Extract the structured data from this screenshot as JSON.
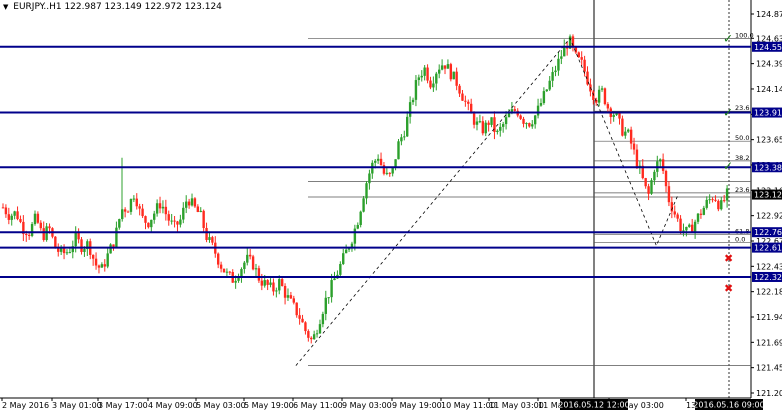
{
  "window": {
    "symbol_label": "EURJPY..H1",
    "ohlc": "122.987 123.149 122.972 123.124",
    "menu_icon": "triangle-down-icon"
  },
  "colors": {
    "bull": "#2ca02c",
    "bear": "#ff2a1f",
    "hline": "#00008b",
    "tag_bg": "#00008b",
    "current_bg": "#000000",
    "grid_text": "#000000",
    "fib": "#000000",
    "check": "#1a7a1a",
    "cross": "#e01010"
  },
  "chart_data": {
    "type": "candlestick",
    "ylim": [
      121.45,
      124.85
    ],
    "y_ticks": [
      "124.870",
      "124.635",
      "124.390",
      "124.145",
      "123.900",
      "123.655",
      "123.410",
      "123.165",
      "122.920",
      "122.675",
      "122.430",
      "122.185",
      "121.940",
      "121.695",
      "121.450",
      "121.205"
    ],
    "x_ticks": [
      "2 May 2016",
      "3 May 01:00",
      "3 May 17:00",
      "4 May 09:00",
      "5 May 03:00",
      "5 May 19:00",
      "6 May 11:00",
      "9 May 03:00",
      "9 May 19:00",
      "10 May 11:00",
      "11 May 03:00",
      "11 Ma",
      "13 May 03:00",
      "13 M"
    ],
    "highlighted_time_labels": [
      "2016.05.12 12:00",
      "2016.05.16 09:00"
    ],
    "current_price": "123.124",
    "horizontal_levels": [
      {
        "price": 124.553,
        "label": "124.553"
      },
      {
        "price": 123.917,
        "label": "123.917"
      },
      {
        "price": 123.388,
        "label": "123.388"
      },
      {
        "price": 122.76,
        "label": "122.760"
      },
      {
        "price": 122.611,
        "label": "122.611"
      },
      {
        "price": 122.327,
        "label": "122.327"
      }
    ],
    "fib_levels_left": [
      {
        "pct": "100.0",
        "price": 124.635
      },
      {
        "pct": "0.0",
        "price": 121.47
      }
    ],
    "fib_levels_right": [
      {
        "pct": "100.0",
        "price": 124.635
      },
      {
        "pct": "23.6",
        "price": 123.93
      },
      {
        "pct": "50.0",
        "price": 123.64
      },
      {
        "pct": "38.2",
        "price": 123.45
      },
      {
        "pct": "23.6",
        "price": 123.14
      },
      {
        "pct": "61.8",
        "price": 122.74
      },
      {
        "pct": "0.0",
        "price": 122.66
      }
    ],
    "price_path": [
      123.0,
      122.92,
      122.95,
      122.8,
      122.76,
      122.9,
      122.72,
      122.8,
      122.6,
      122.55,
      122.58,
      122.7,
      122.62,
      122.65,
      122.45,
      122.4,
      122.55,
      122.7,
      122.98,
      123.0,
      123.15,
      122.9,
      122.85,
      122.95,
      123.05,
      122.9,
      122.8,
      122.88,
      123.1,
      123.0,
      122.92,
      122.7,
      122.6,
      122.45,
      122.35,
      122.3,
      122.4,
      122.5,
      122.45,
      122.3,
      122.25,
      122.2,
      122.28,
      122.15,
      122.05,
      121.95,
      121.8,
      121.7,
      121.9,
      122.1,
      122.25,
      122.4,
      122.55,
      122.7,
      122.9,
      123.2,
      123.4,
      123.5,
      123.3,
      123.3,
      123.6,
      123.75,
      124.0,
      124.25,
      124.35,
      124.2,
      124.35,
      124.4,
      124.3,
      124.2,
      124.05,
      123.9,
      123.8,
      123.75,
      123.85,
      123.7,
      123.8,
      123.9,
      123.95,
      123.85,
      123.82,
      123.9,
      124.05,
      124.2,
      124.35,
      124.5,
      124.62,
      124.45,
      124.38,
      124.2,
      124.05,
      124.12,
      123.95,
      123.9,
      123.75,
      123.7,
      123.5,
      123.3,
      123.1,
      123.4,
      123.45,
      123.1,
      122.95,
      122.8,
      122.75,
      122.85,
      122.95,
      123.05,
      123.12,
      123.0,
      123.124
    ],
    "zigzag": [
      [
        0.394,
        121.47
      ],
      [
        0.759,
        124.635
      ],
      [
        0.874,
        122.63
      ],
      [
        0.903,
        123.124
      ]
    ],
    "check_marks": [
      124.635,
      123.917,
      123.4
    ],
    "cross_marks": [
      122.51,
      122.22
    ]
  }
}
